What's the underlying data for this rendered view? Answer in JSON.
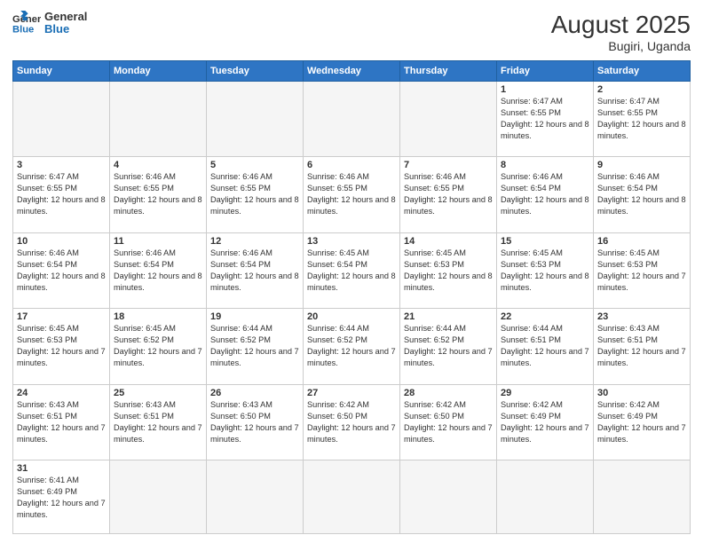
{
  "header": {
    "logo_general": "General",
    "logo_blue": "Blue",
    "title": "August 2025",
    "subtitle": "Bugiri, Uganda"
  },
  "weekdays": [
    "Sunday",
    "Monday",
    "Tuesday",
    "Wednesday",
    "Thursday",
    "Friday",
    "Saturday"
  ],
  "weeks": [
    [
      {
        "day": "",
        "info": "",
        "empty": true
      },
      {
        "day": "",
        "info": "",
        "empty": true
      },
      {
        "day": "",
        "info": "",
        "empty": true
      },
      {
        "day": "",
        "info": "",
        "empty": true
      },
      {
        "day": "",
        "info": "",
        "empty": true
      },
      {
        "day": "1",
        "info": "Sunrise: 6:47 AM\nSunset: 6:55 PM\nDaylight: 12 hours and 8 minutes."
      },
      {
        "day": "2",
        "info": "Sunrise: 6:47 AM\nSunset: 6:55 PM\nDaylight: 12 hours and 8 minutes."
      }
    ],
    [
      {
        "day": "3",
        "info": "Sunrise: 6:47 AM\nSunset: 6:55 PM\nDaylight: 12 hours and 8 minutes."
      },
      {
        "day": "4",
        "info": "Sunrise: 6:46 AM\nSunset: 6:55 PM\nDaylight: 12 hours and 8 minutes."
      },
      {
        "day": "5",
        "info": "Sunrise: 6:46 AM\nSunset: 6:55 PM\nDaylight: 12 hours and 8 minutes."
      },
      {
        "day": "6",
        "info": "Sunrise: 6:46 AM\nSunset: 6:55 PM\nDaylight: 12 hours and 8 minutes."
      },
      {
        "day": "7",
        "info": "Sunrise: 6:46 AM\nSunset: 6:55 PM\nDaylight: 12 hours and 8 minutes."
      },
      {
        "day": "8",
        "info": "Sunrise: 6:46 AM\nSunset: 6:54 PM\nDaylight: 12 hours and 8 minutes."
      },
      {
        "day": "9",
        "info": "Sunrise: 6:46 AM\nSunset: 6:54 PM\nDaylight: 12 hours and 8 minutes."
      }
    ],
    [
      {
        "day": "10",
        "info": "Sunrise: 6:46 AM\nSunset: 6:54 PM\nDaylight: 12 hours and 8 minutes."
      },
      {
        "day": "11",
        "info": "Sunrise: 6:46 AM\nSunset: 6:54 PM\nDaylight: 12 hours and 8 minutes."
      },
      {
        "day": "12",
        "info": "Sunrise: 6:46 AM\nSunset: 6:54 PM\nDaylight: 12 hours and 8 minutes."
      },
      {
        "day": "13",
        "info": "Sunrise: 6:45 AM\nSunset: 6:54 PM\nDaylight: 12 hours and 8 minutes."
      },
      {
        "day": "14",
        "info": "Sunrise: 6:45 AM\nSunset: 6:53 PM\nDaylight: 12 hours and 8 minutes."
      },
      {
        "day": "15",
        "info": "Sunrise: 6:45 AM\nSunset: 6:53 PM\nDaylight: 12 hours and 8 minutes."
      },
      {
        "day": "16",
        "info": "Sunrise: 6:45 AM\nSunset: 6:53 PM\nDaylight: 12 hours and 7 minutes."
      }
    ],
    [
      {
        "day": "17",
        "info": "Sunrise: 6:45 AM\nSunset: 6:53 PM\nDaylight: 12 hours and 7 minutes."
      },
      {
        "day": "18",
        "info": "Sunrise: 6:45 AM\nSunset: 6:52 PM\nDaylight: 12 hours and 7 minutes."
      },
      {
        "day": "19",
        "info": "Sunrise: 6:44 AM\nSunset: 6:52 PM\nDaylight: 12 hours and 7 minutes."
      },
      {
        "day": "20",
        "info": "Sunrise: 6:44 AM\nSunset: 6:52 PM\nDaylight: 12 hours and 7 minutes."
      },
      {
        "day": "21",
        "info": "Sunrise: 6:44 AM\nSunset: 6:52 PM\nDaylight: 12 hours and 7 minutes."
      },
      {
        "day": "22",
        "info": "Sunrise: 6:44 AM\nSunset: 6:51 PM\nDaylight: 12 hours and 7 minutes."
      },
      {
        "day": "23",
        "info": "Sunrise: 6:43 AM\nSunset: 6:51 PM\nDaylight: 12 hours and 7 minutes."
      }
    ],
    [
      {
        "day": "24",
        "info": "Sunrise: 6:43 AM\nSunset: 6:51 PM\nDaylight: 12 hours and 7 minutes."
      },
      {
        "day": "25",
        "info": "Sunrise: 6:43 AM\nSunset: 6:51 PM\nDaylight: 12 hours and 7 minutes."
      },
      {
        "day": "26",
        "info": "Sunrise: 6:43 AM\nSunset: 6:50 PM\nDaylight: 12 hours and 7 minutes."
      },
      {
        "day": "27",
        "info": "Sunrise: 6:42 AM\nSunset: 6:50 PM\nDaylight: 12 hours and 7 minutes."
      },
      {
        "day": "28",
        "info": "Sunrise: 6:42 AM\nSunset: 6:50 PM\nDaylight: 12 hours and 7 minutes."
      },
      {
        "day": "29",
        "info": "Sunrise: 6:42 AM\nSunset: 6:49 PM\nDaylight: 12 hours and 7 minutes."
      },
      {
        "day": "30",
        "info": "Sunrise: 6:42 AM\nSunset: 6:49 PM\nDaylight: 12 hours and 7 minutes."
      }
    ],
    [
      {
        "day": "31",
        "info": "Sunrise: 6:41 AM\nSunset: 6:49 PM\nDaylight: 12 hours and 7 minutes."
      },
      {
        "day": "",
        "info": "",
        "empty": true
      },
      {
        "day": "",
        "info": "",
        "empty": true
      },
      {
        "day": "",
        "info": "",
        "empty": true
      },
      {
        "day": "",
        "info": "",
        "empty": true
      },
      {
        "day": "",
        "info": "",
        "empty": true
      },
      {
        "day": "",
        "info": "",
        "empty": true
      }
    ]
  ]
}
